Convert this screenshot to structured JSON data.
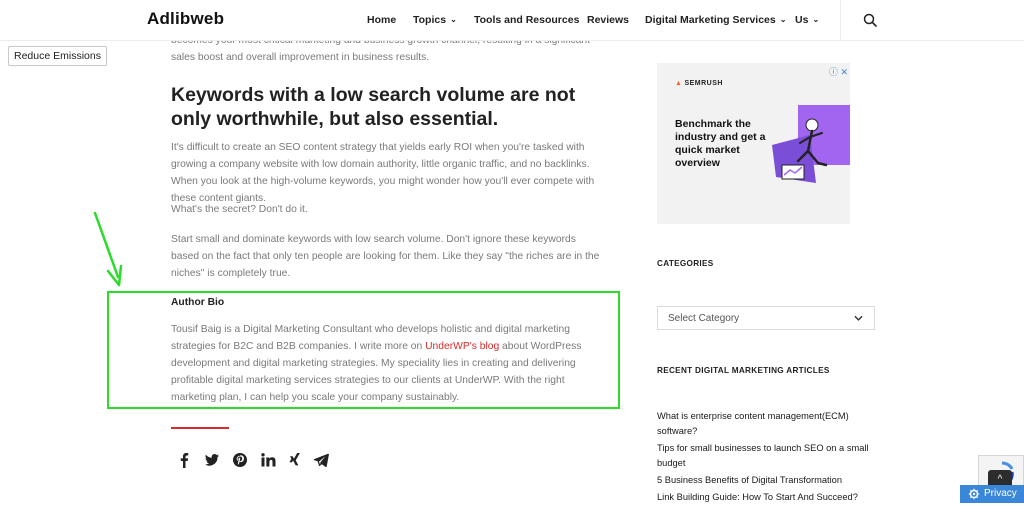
{
  "header": {
    "logo": "Adlibweb",
    "nav": [
      {
        "label": "Home",
        "dropdown": false
      },
      {
        "label": "Topics",
        "dropdown": true
      },
      {
        "label": "Tools and Resources",
        "dropdown": false
      },
      {
        "label": "Reviews",
        "dropdown": false
      },
      {
        "label": "Digital Marketing Services",
        "dropdown": true
      },
      {
        "label": "Us",
        "dropdown": true
      }
    ],
    "search_icon": "search-icon"
  },
  "reduce_button": "Reduce Emissions",
  "article": {
    "intro_tail": "becomes your most critical marketing and business growth channel, resulting in a significant sales boost and overall improvement in business results.",
    "heading": "Keywords with a low search volume are not only worthwhile, but also essential.",
    "para1": "It's difficult to create an SEO content strategy that yields early ROI when you're tasked with growing a company website with low domain authority, little organic traffic, and no backlinks. When you look at the high-volume keywords, you might wonder how you'll ever compete with these content giants.",
    "para2": "What's the secret? Don't do it.",
    "para3": "Start small and dominate keywords with low search volume. Don't ignore these keywords based on the fact that only ten people are looking for them. Like they say \"the riches are in the niches\" is completely true.",
    "bio_title": "Author Bio",
    "bio_before": "Tousif Baig is a Digital Marketing Consultant who develops holistic and digital marketing strategies for B2C and B2B companies. I write more on ",
    "bio_link": "UnderWP's blog",
    "bio_after": " about WordPress development and digital marketing strategies. My speciality lies in creating and delivering profitable digital marketing services strategies to our clients at UnderWP.  With the right marketing plan, I can help you scale your company sustainably.",
    "share_icons": [
      "facebook-icon",
      "twitter-icon",
      "pinterest-icon",
      "linkedin-icon",
      "xing-icon",
      "telegram-icon"
    ]
  },
  "sidebar": {
    "ad": {
      "brand": "SEMRUSH",
      "headline": "Benchmark the industry and get a quick market overview",
      "badge": "ⓘ ✕"
    },
    "categories_heading": "CATEGORIES",
    "categories_select": "Select Category",
    "recent_heading": "RECENT DIGITAL MARKETING ARTICLES",
    "recent": [
      "What is enterprise content management(ECM) software?",
      "Tips for small businesses to launch SEO on a small budget",
      "5 Business Benefits of Digital Transformation",
      "Link Building Guide: How To Start And Succeed?"
    ]
  },
  "footer": {
    "back_to_top": "^",
    "privacy": "Privacy"
  },
  "colors": {
    "accent_red": "#d62b2b",
    "annotation_green": "#2bdc2b",
    "privacy_blue": "#3a86d9"
  }
}
